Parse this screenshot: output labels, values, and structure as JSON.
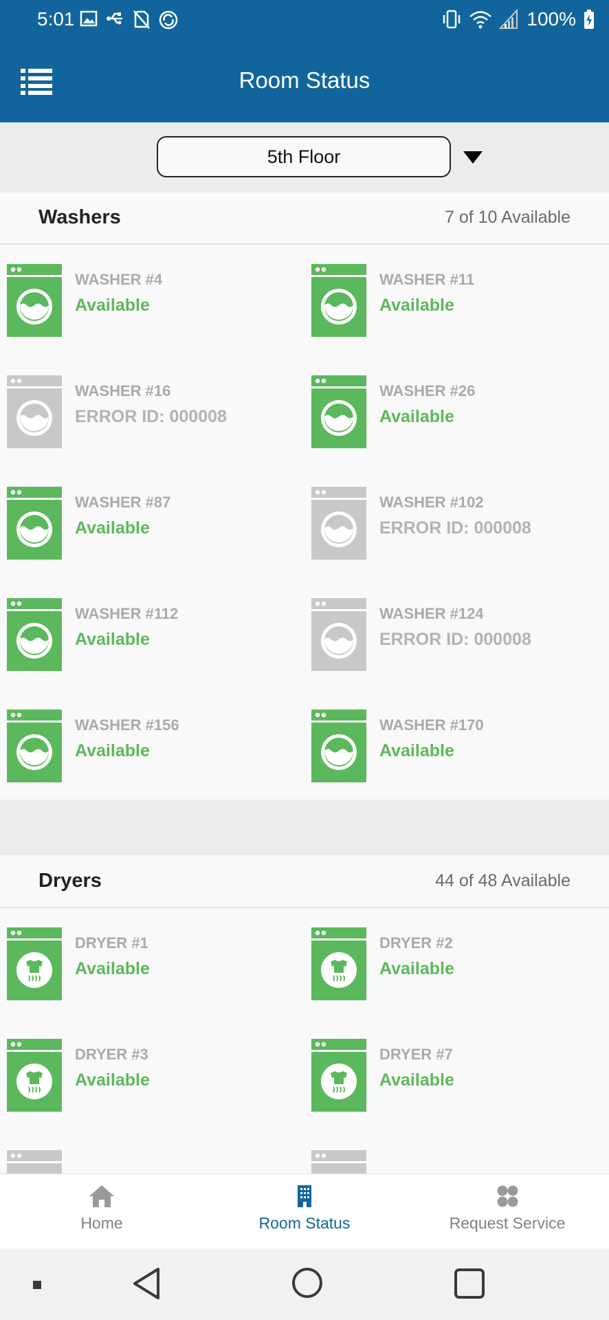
{
  "status_bar": {
    "time": "5:01",
    "battery": "100%",
    "left_icons": [
      "image-icon",
      "usb-icon",
      "no-sim-icon",
      "sync-icon"
    ],
    "right_icons": [
      "vibrate-icon",
      "wifi-icon",
      "signal-icon",
      "battery-icon"
    ]
  },
  "app_bar": {
    "title": "Room Status",
    "menu_icon": "list-menu-icon"
  },
  "floor_selector": {
    "value": "5th Floor"
  },
  "washers": {
    "title": "Washers",
    "count": "7 of 10 Available",
    "items": [
      {
        "name": "WASHER #4",
        "status": "Available",
        "state": "available"
      },
      {
        "name": "WASHER #11",
        "status": "Available",
        "state": "available"
      },
      {
        "name": "WASHER #16",
        "status": "ERROR ID: 000008",
        "state": "error"
      },
      {
        "name": "WASHER #26",
        "status": "Available",
        "state": "available"
      },
      {
        "name": "WASHER #87",
        "status": "Available",
        "state": "available"
      },
      {
        "name": "WASHER #102",
        "status": "ERROR ID: 000008",
        "state": "error"
      },
      {
        "name": "WASHER #112",
        "status": "Available",
        "state": "available"
      },
      {
        "name": "WASHER #124",
        "status": "ERROR ID: 000008",
        "state": "error"
      },
      {
        "name": "WASHER #156",
        "status": "Available",
        "state": "available"
      },
      {
        "name": "WASHER #170",
        "status": "Available",
        "state": "available"
      }
    ]
  },
  "dryers": {
    "title": "Dryers",
    "count": "44 of 48 Available",
    "items": [
      {
        "name": "DRYER #1",
        "status": "Available",
        "state": "available"
      },
      {
        "name": "DRYER #2",
        "status": "Available",
        "state": "available"
      },
      {
        "name": "DRYER #3",
        "status": "Available",
        "state": "available"
      },
      {
        "name": "DRYER #7",
        "status": "Available",
        "state": "available"
      }
    ]
  },
  "bottom_nav": {
    "items": [
      {
        "label": "Home",
        "icon": "home-icon",
        "active": false
      },
      {
        "label": "Room Status",
        "icon": "building-icon",
        "active": true
      },
      {
        "label": "Request Service",
        "icon": "grid-dots-icon",
        "active": false
      }
    ]
  },
  "colors": {
    "primary": "#12659c",
    "available": "#5cb85c",
    "error": "#c8c8c8",
    "muted_text": "#aaaaaa"
  }
}
